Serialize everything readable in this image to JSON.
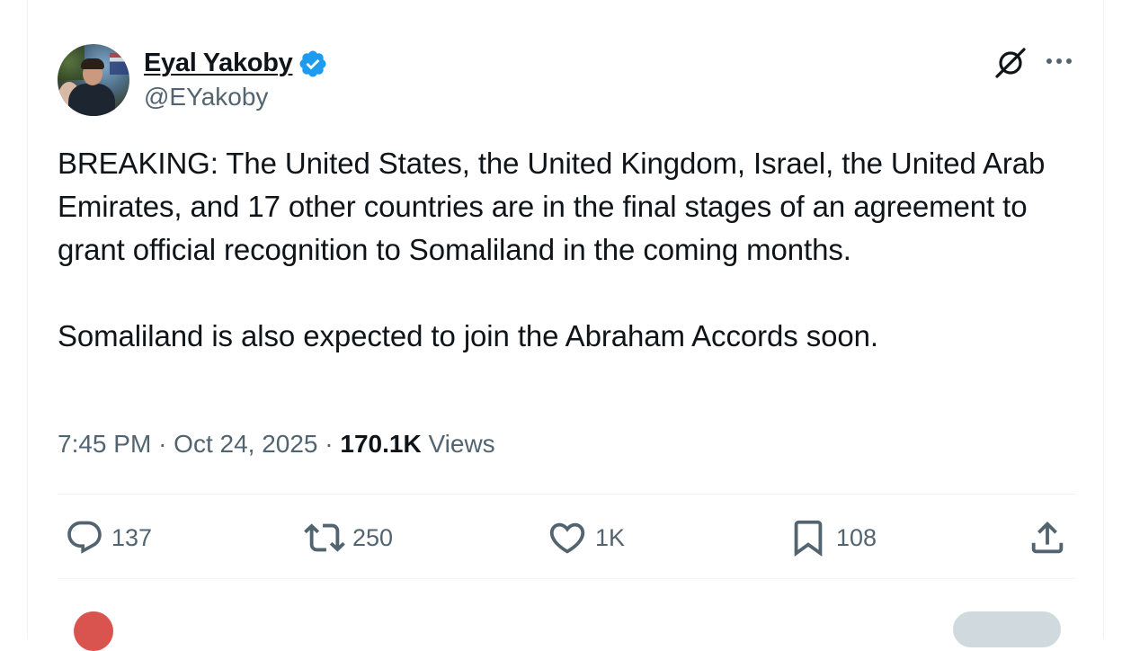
{
  "author": {
    "display_name": "Eyal Yakoby",
    "handle": "@EYakoby",
    "verified": true,
    "verified_color": "#1d9bf0"
  },
  "tweet": {
    "text": "BREAKING: The United States, the United Kingdom, Israel, the United Arab Emirates, and 17 other countries are in the final stages of an agreement to grant official recognition to Somaliland in the coming months.\n\nSomaliland is also expected to join the Abraham Accords soon.",
    "time": "7:45 PM",
    "separator": "·",
    "date": "Oct 24, 2025",
    "views_count": "170.1K",
    "views_label": "Views"
  },
  "actions": {
    "replies": "137",
    "reposts": "250",
    "likes": "1K",
    "bookmarks": "108"
  },
  "icons": {
    "grok": "grok-icon",
    "more": "more-icon",
    "reply": "reply-icon",
    "repost": "repost-icon",
    "like": "heart-icon",
    "bookmark": "bookmark-icon",
    "share": "share-icon"
  },
  "colors": {
    "text": "#0f1419",
    "secondary": "#536471",
    "divider": "#eff3f4",
    "verified": "#1d9bf0"
  }
}
